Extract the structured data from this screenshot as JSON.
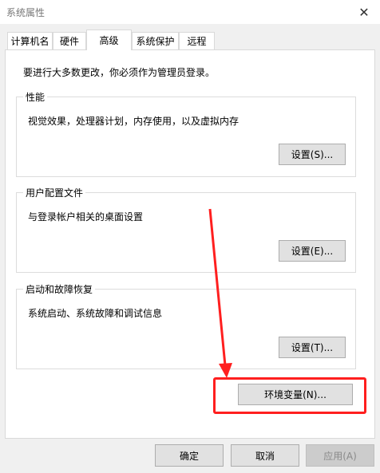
{
  "window": {
    "title": "系统属性",
    "close_glyph": "✕"
  },
  "tabs": [
    {
      "label": "计算机名"
    },
    {
      "label": "硬件"
    },
    {
      "label": "高级",
      "active": true
    },
    {
      "label": "系统保护"
    },
    {
      "label": "远程"
    }
  ],
  "notice": "要进行大多数更改，你必须作为管理员登录。",
  "groups": {
    "performance": {
      "label": "性能",
      "desc": "视觉效果，处理器计划，内存使用，以及虚拟内存",
      "button": "设置(S)..."
    },
    "user_profiles": {
      "label": "用户配置文件",
      "desc": "与登录帐户相关的桌面设置",
      "button": "设置(E)..."
    },
    "startup": {
      "label": "启动和故障恢复",
      "desc": "系统启动、系统故障和调试信息",
      "button": "设置(T)..."
    }
  },
  "env_button": "环境变量(N)...",
  "footer": {
    "ok": "确定",
    "cancel": "取消",
    "apply": "应用(A)"
  },
  "colors": {
    "annotation": "#ff1f1f",
    "button_face": "#e1e1e1",
    "border": "#adadad"
  }
}
